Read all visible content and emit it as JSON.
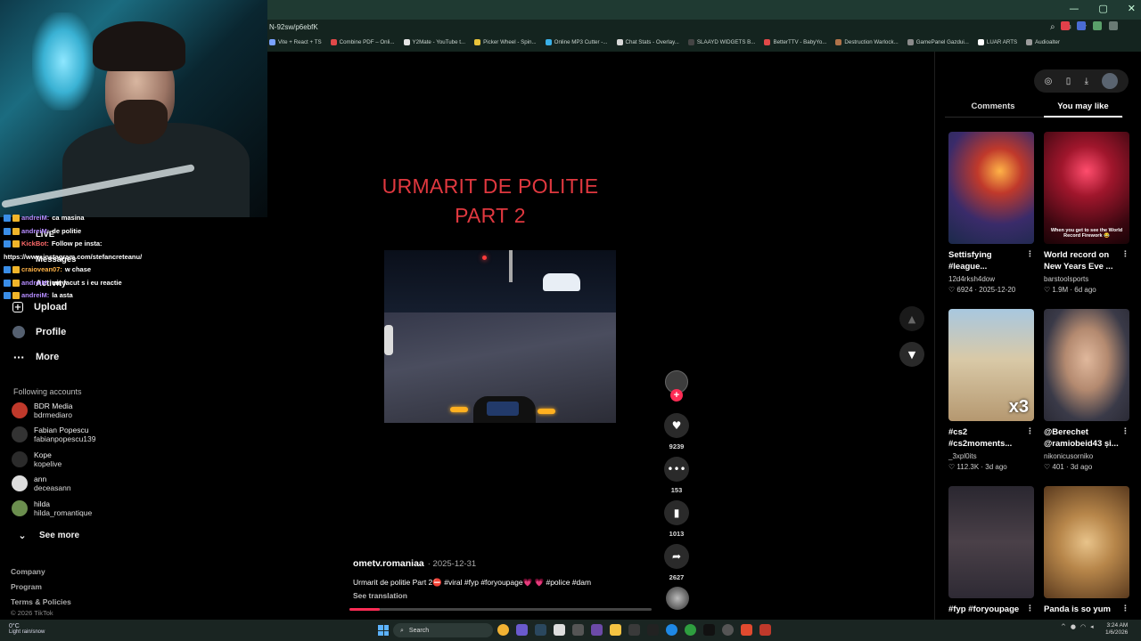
{
  "browser": {
    "url": "N-92sw/p6ebfK",
    "window_controls": [
      "—",
      "▢",
      "✕"
    ],
    "bookmarks": [
      {
        "label": "Vite + React + TS",
        "color": "#7aa2ff"
      },
      {
        "label": "Combine PDF – Onli...",
        "color": "#e04848"
      },
      {
        "label": "Y2Mate - YouTube t...",
        "color": "#e5e5e5"
      },
      {
        "label": "Picker Wheel - Spin...",
        "color": "#e8c33a"
      },
      {
        "label": "Online MP3 Cutter -...",
        "color": "#3ab0e8"
      },
      {
        "label": "Chat Stats - Overlay...",
        "color": "#d8d8d8"
      },
      {
        "label": "SLAAYD WIDGETS B...",
        "color": "#444444"
      },
      {
        "label": "BetterTTV - BabyYo...",
        "color": "#e04848"
      },
      {
        "label": "Destruction Warlock...",
        "color": "#b0734a"
      },
      {
        "label": "GamePanel Gazdui...",
        "color": "#8a8a8a"
      },
      {
        "label": "LUAR ARTS",
        "color": "#ffffff"
      },
      {
        "label": "Audioalter",
        "color": "#9b9b9b"
      }
    ]
  },
  "chat": [
    {
      "user": "andreiM:",
      "msg": "ca masina",
      "color": "#b58cff"
    },
    {
      "user": "andreiM:",
      "msg": "de politie",
      "color": "#b58cff"
    },
    {
      "user": "KickBot:",
      "msg": "Follow pe insta:",
      "color": "#ff6a6a"
    },
    {
      "user": "",
      "msg": "https://www.instagram.com/stefancreteanu/",
      "color": "#ffffff"
    },
    {
      "user": "craiovean07:",
      "msg": "w chase",
      "color": "#ffb347"
    },
    {
      "user": "andreiM:",
      "msg": "am facut s i eu reactie",
      "color": "#b58cff"
    },
    {
      "user": "andreiM:",
      "msg": "la asta",
      "color": "#b58cff"
    }
  ],
  "nav": {
    "live": "LIVE",
    "messages": "Messages",
    "activity": "Activity",
    "upload": "Upload",
    "profile": "Profile",
    "more": "More",
    "following_title": "Following accounts",
    "accounts": [
      {
        "name": "BDR Media",
        "user": "bdrmediaro",
        "color": "#c0392b"
      },
      {
        "name": "Fabian Popescu",
        "user": "fabianpopescu139",
        "color": "#333333"
      },
      {
        "name": "Kope",
        "user": "kopelive",
        "color": "#2b2b2b"
      },
      {
        "name": "ann",
        "user": "deceasann",
        "color": "#dddddd"
      },
      {
        "name": "hilda",
        "user": "hilda_romantique",
        "color": "#6b8e4e"
      }
    ],
    "see_more": "See more",
    "footer": [
      "Company",
      "Program",
      "Terms & Policies"
    ],
    "copyright": "© 2026 TikTok"
  },
  "video": {
    "title_line1": "URMARIT DE POLITIE",
    "title_line2": "PART 2",
    "author": "ometv.romaniaa",
    "date": "· 2025-12-31",
    "caption": "Urmarit de politie Part 2⛔ #viral #fyp #foryoupage💗 💗 #police #dam",
    "see_translation": "See translation",
    "progress": 0.1,
    "likes": "9239",
    "comments": "153",
    "saves": "1013",
    "shares": "2627",
    "accent": "#fe2c55"
  },
  "right": {
    "tab_comments": "Comments",
    "tab_you_may_like": "You may like",
    "cards": [
      {
        "title": "Settisfying #league...",
        "user": "12d4rksh4dow",
        "stats": "♡ 6924 · 2025-12-20",
        "thumb_text": ""
      },
      {
        "title": "World record on New Years Eve ...",
        "user": "barstoolsports",
        "stats": "♡ 1.9M · 6d ago",
        "thumb_text": "When you get to see the World Record Firework 😂"
      },
      {
        "title": "#cs2 #cs2moments...",
        "user": "_3xpl0its",
        "stats": "♡ 112.3K · 3d ago",
        "thumb_text": "x3"
      },
      {
        "title": "@Berechet @ramiobeid43 și...",
        "user": "nikonicusorniko",
        "stats": "♡ 401 · 3d ago",
        "thumb_text": ""
      },
      {
        "title": "#fyp #foryoupage",
        "user": "",
        "stats": "",
        "thumb_text": ""
      },
      {
        "title": "Panda is so yum",
        "user": "",
        "stats": "",
        "thumb_text": ""
      }
    ]
  },
  "taskbar": {
    "temp": "0°C",
    "weather": "Light rain/snow",
    "search": "Search",
    "time": "3:24 AM",
    "date": "1/6/2026"
  }
}
